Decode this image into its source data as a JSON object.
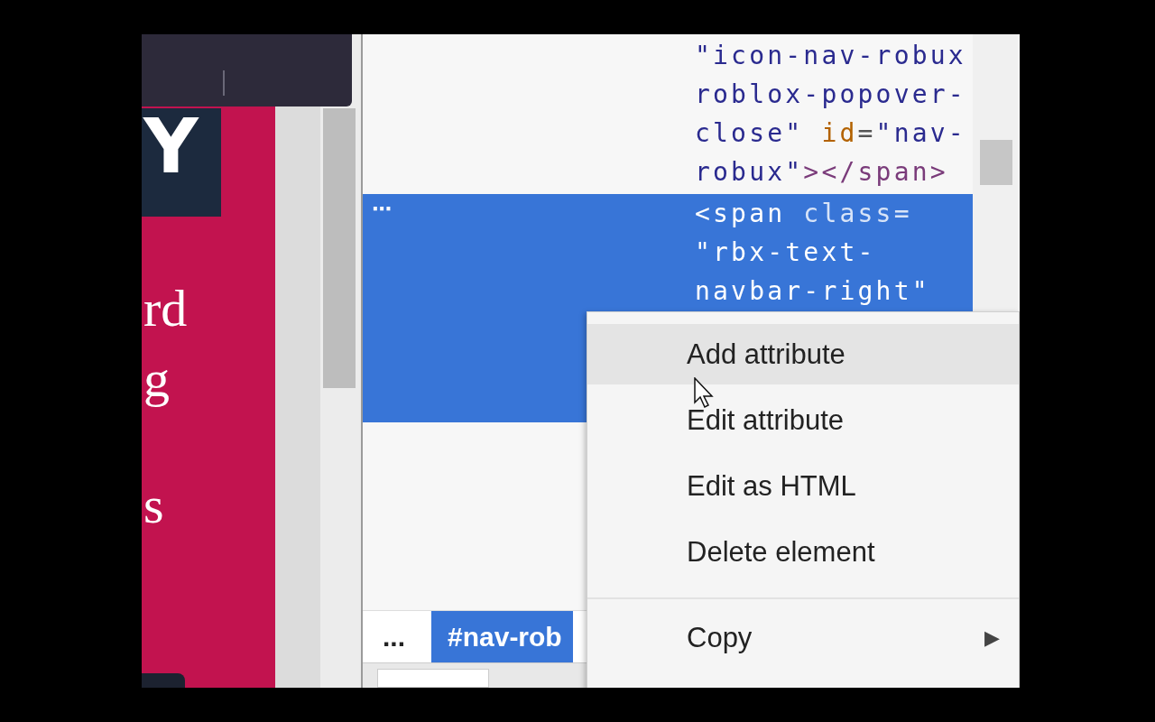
{
  "page_preview": {
    "heading_letter": "Y",
    "text_fragments": [
      "rd",
      "g",
      "s"
    ]
  },
  "elements": {
    "nodes": [
      {
        "selected": false,
        "lines": [
          [
            {
              "kind": "value",
              "text": "\"icon-nav-robux"
            }
          ],
          [
            {
              "kind": "value",
              "text": "roblox-popover-"
            }
          ],
          [
            {
              "kind": "value",
              "text": "close\" "
            },
            {
              "kind": "attr",
              "text": "id"
            },
            {
              "kind": "punct",
              "text": "="
            },
            {
              "kind": "value",
              "text": "\"nav-"
            }
          ],
          [
            {
              "kind": "value",
              "text": "robux\""
            },
            {
              "kind": "tag",
              "text": "></span>"
            }
          ]
        ]
      },
      {
        "selected": true,
        "marker": "⋯",
        "lines": [
          [
            {
              "kind": "tag",
              "text": "<span "
            },
            {
              "kind": "attr",
              "text": "class="
            }
          ],
          [
            {
              "kind": "value",
              "text": "\"rbx-text-"
            }
          ],
          [
            {
              "kind": "value",
              "text": "navbar-right\""
            }
          ]
        ]
      }
    ]
  },
  "breadcrumbs": [
    {
      "label": "...",
      "selected": false
    },
    {
      "label": "#nav-rob",
      "selected": true
    }
  ],
  "context_menu": {
    "items": [
      {
        "kind": "item",
        "label": "Add attribute",
        "selected": true
      },
      {
        "kind": "item",
        "label": "Edit attribute",
        "selected": false
      },
      {
        "kind": "item",
        "label": "Edit as HTML",
        "selected": false
      },
      {
        "kind": "item",
        "label": "Delete element",
        "selected": false
      },
      {
        "kind": "separator"
      },
      {
        "kind": "submenu",
        "label": "Copy",
        "selected": false,
        "arrow": "▶"
      }
    ]
  }
}
